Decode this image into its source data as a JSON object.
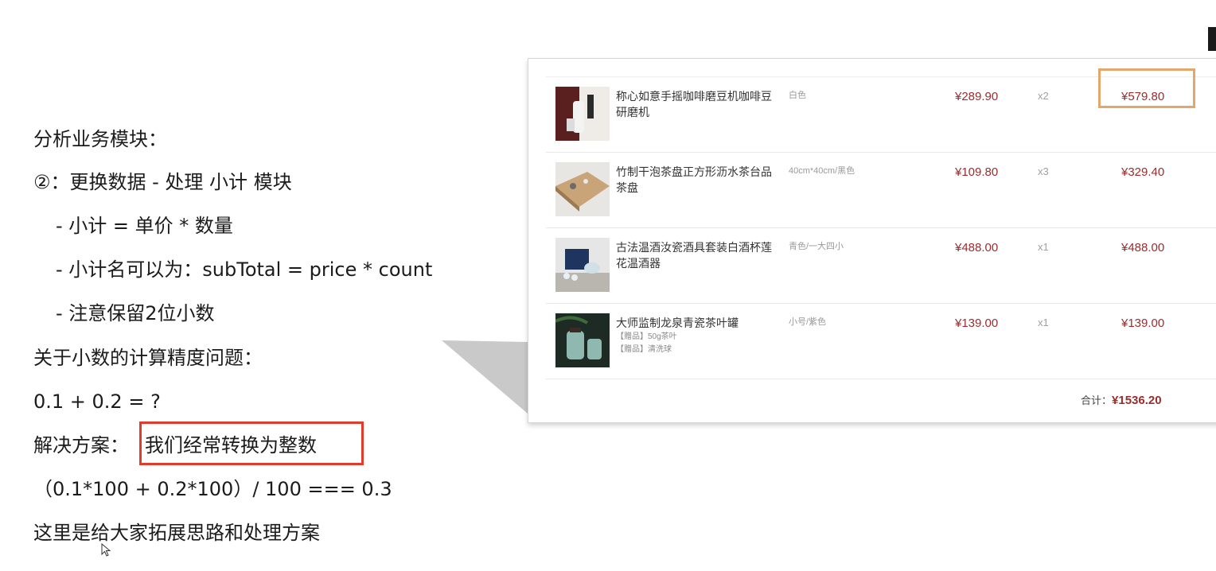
{
  "notes": {
    "l1": "分析业务模块：",
    "l2": "②：更换数据 - 处理 小计 模块",
    "l3": "-  小计 =  单价 *  数量",
    "l4": "-  小计名可以为：subTotal  =  price * count",
    "l5": "-  注意保留2位小数",
    "l6": "关于小数的计算精度问题：",
    "l7": "0.1 + 0.2 = ?",
    "l8_label": "解决方案：",
    "l8_answer": "我们经常转换为整数",
    "l9": "（0.1*100 + 0.2*100）/ 100  === 0.3",
    "l10": "这里是给大家拓展思路和处理方案"
  },
  "cart": {
    "items": [
      {
        "name": "称心如意手摇咖啡磨豆机咖啡豆研磨机",
        "attr": "白色",
        "price": "¥289.90",
        "qty": "x2",
        "subtotal": "¥579.80",
        "thumb": "coffee-grinder-thumbnail",
        "gifts": []
      },
      {
        "name": "竹制干泡茶盘正方形沥水茶台品茶盘",
        "attr": "40cm*40cm/黑色",
        "price": "¥109.80",
        "qty": "x3",
        "subtotal": "¥329.40",
        "thumb": "tea-tray-thumbnail",
        "gifts": []
      },
      {
        "name": "古法温酒汝瓷酒具套装白酒杯莲花温酒器",
        "attr": "青色/一大四小",
        "price": "¥488.00",
        "qty": "x1",
        "subtotal": "¥488.00",
        "thumb": "wine-set-thumbnail",
        "gifts": []
      },
      {
        "name": "大师监制龙泉青瓷茶叶罐",
        "attr": "小号/紫色",
        "price": "¥139.00",
        "qty": "x1",
        "subtotal": "¥139.00",
        "thumb": "tea-canister-thumbnail",
        "gifts": [
          "【赠品】50g茶叶",
          "【赠品】清洗球"
        ]
      }
    ],
    "total_label": "合计：",
    "total_value": "¥1536.20"
  },
  "colors": {
    "price_red": "#9b2c2c",
    "highlight_red": "#e23b2a",
    "highlight_orange": "#e3a76b"
  }
}
